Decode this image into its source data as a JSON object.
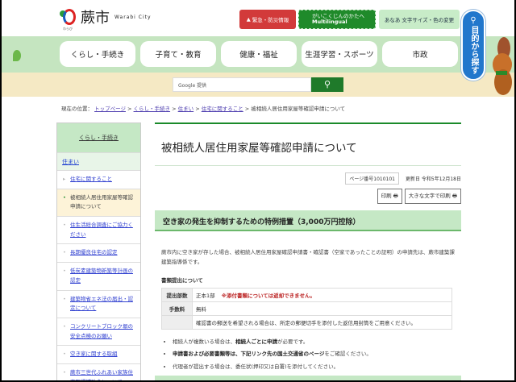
{
  "header": {
    "city_name": "蕨市",
    "city_en": "Warabi City",
    "logo_sub": "わらび",
    "emergency_label": "緊急・防災情報",
    "multi_jp": "がいこくじんのかたへ",
    "multi_en": "Multilingual",
    "font_label": "あなあ 文字サイズ・色の変更",
    "purpose_label": "目的から探す"
  },
  "nav": [
    "くらし・手続き",
    "子育て・教育",
    "健康・福祉",
    "生涯学習・スポーツ",
    "市政"
  ],
  "search": {
    "placeholder": "Google 提供",
    "button_icon": "search-icon"
  },
  "breadcrumb": {
    "label": "現在の位置：",
    "items": [
      "トップページ",
      "くらし・手続き",
      "住まい",
      "住宅に関すること"
    ],
    "current": "被相続人居住用家屋等確認申請について"
  },
  "sidebar": {
    "heading": "くらし・手続き",
    "sub": "住まい",
    "items": [
      "住宅に関すること",
      "被相続人居住用家屋等確認申請について",
      "住生活総合調査にご協力ください",
      "長期優良住宅の認定",
      "低炭素建築物新築等計画の認定",
      "建築物省エネ法の届出・認定について",
      "コンクリートブロック塀の安全点検のお願い",
      "空き家に関する取組",
      "蕨市三世代ふれあい家族住宅取得補助金について"
    ]
  },
  "main": {
    "title": "被相続人居住用家屋等確認申請について",
    "page_no": "ページ番号1010101",
    "updated": "更新日 令和5年12月18日",
    "print": "印刷",
    "print_large": "大きな文字で印刷",
    "section": "空き家の発生を抑制するための特例措置（3,000万円控除）",
    "para": "蕨市内に空き家が存した場合、被相続人居住用家屋確認申請書・確認書（空家であったことの証明）の申請先は、蕨市建築課建築指導係です。",
    "sub": "書類提出について",
    "table": [
      {
        "h": "提出部数",
        "v": "正本1部",
        "note": "※添付書類については返却できません。"
      },
      {
        "h": "手数料",
        "v": "無料",
        "note": ""
      },
      {
        "h": "",
        "v": "確認書の郵送を希望される場合は、所定の郵便切手を添付した返信用封筒をご用意ください。",
        "note": ""
      }
    ],
    "bullets": [
      [
        "相続人が複数いる場合は、",
        "相続人ごとに申請",
        "が必要です。"
      ],
      [
        "",
        "申請書および必要書類等は、下記リンク先の国土交通省のページ",
        "をご確認ください。"
      ],
      [
        "代理者が提出する場合は、委任状(押印又は自署)を添付してください。",
        "",
        ""
      ]
    ]
  }
}
